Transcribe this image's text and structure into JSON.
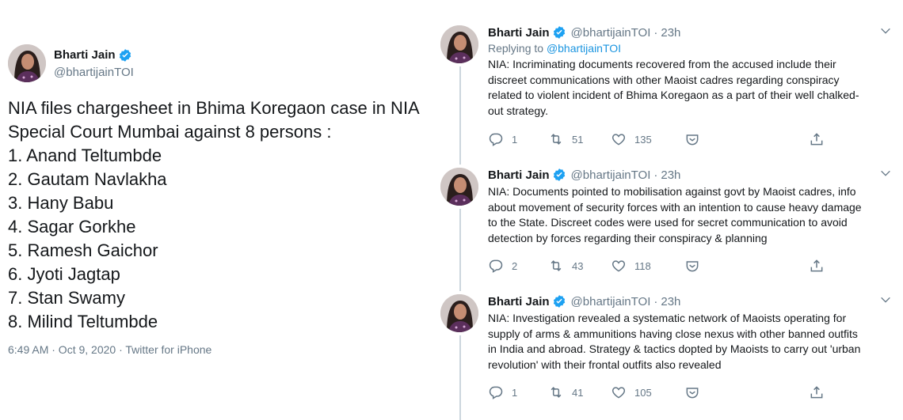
{
  "main_tweet": {
    "author_name": "Bharti Jain",
    "author_handle": "@bhartijainTOI",
    "text_lines": [
      "NIA files chargesheet in Bhima Koregaon case in NIA",
      "Special Court Mumbai against 8 persons :",
      "1. Anand Teltumbde",
      "2. Gautam Navlakha",
      "3. Hany Babu",
      "4. Sagar Gorkhe",
      "5. Ramesh Gaichor",
      "6. Jyoti Jagtap",
      "7. Stan Swamy",
      "8. Milind Teltumbde"
    ],
    "timestamp": "6:49 AM · Oct 9, 2020",
    "source": "Twitter for iPhone"
  },
  "replies": [
    {
      "author_name": "Bharti Jain",
      "author_handle": "@bhartijainTOI",
      "dot": "·",
      "time": "23h",
      "replying_to_label": "Replying to",
      "replying_to_handle": "@bhartijainTOI",
      "text_lines": [
        "NIA: Incriminating documents recovered from the accused include their",
        "discreet communications with other Maoist cadres regarding conspiracy",
        "related to violent incident of Bhima Koregaon as a part of their well chalked-",
        "out strategy."
      ],
      "reply_count": "1",
      "retweet_count": "51",
      "like_count": "135"
    },
    {
      "author_name": "Bharti Jain",
      "author_handle": "@bhartijainTOI",
      "dot": "·",
      "time": "23h",
      "text_lines": [
        "NIA: Documents pointed to mobilisation against govt by Maoist cadres, info",
        "about movement of security forces with an intention to cause heavy damage",
        "to the State. Discreet codes were used for secret communication to avoid",
        "detection by forces regarding their conspiracy & planning"
      ],
      "reply_count": "2",
      "retweet_count": "43",
      "like_count": "118"
    },
    {
      "author_name": "Bharti Jain",
      "author_handle": "@bhartijainTOI",
      "dot": "·",
      "time": "23h",
      "text_lines": [
        "NIA: Investigation revealed a systematic network of Maoists operating for",
        "supply of arms & ammunitions having close nexus with other banned outfits",
        "in India and abroad. Strategy & tactics dopted by Maoists to carry out 'urban",
        "revolution' with their frontal outfits also revealed"
      ],
      "reply_count": "1",
      "retweet_count": "41",
      "like_count": "105"
    }
  ],
  "icons": {
    "verified": "verified-badge-icon",
    "caret": "chevron-down-icon",
    "reply": "reply-icon",
    "retweet": "retweet-icon",
    "like": "heart-icon",
    "dm": "direct-message-icon",
    "share": "share-icon"
  },
  "colors": {
    "text": "#14171a",
    "secondary": "#657786",
    "link": "#1b95e0",
    "verified": "#1da1f2",
    "thread_line": "#ccd6dd"
  }
}
